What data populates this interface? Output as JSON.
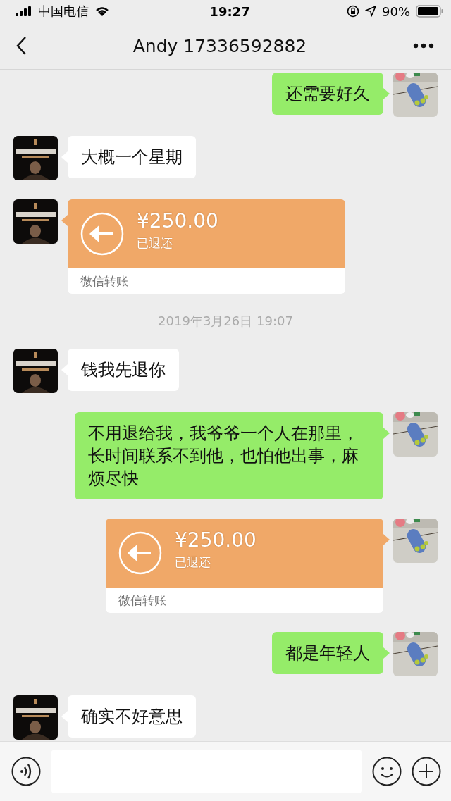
{
  "status_bar": {
    "carrier": "中国电信",
    "time": "19:27",
    "battery": "90%"
  },
  "nav": {
    "title": "Andy 17336592882"
  },
  "messages": [
    {
      "kind": "text",
      "outgoing": true,
      "text": "还需要好久"
    },
    {
      "kind": "text",
      "outgoing": false,
      "text": "大概一个星期"
    },
    {
      "kind": "transfer",
      "outgoing": false,
      "amount": "¥250.00",
      "status": "已退还",
      "label": "微信转账"
    },
    {
      "kind": "time",
      "text": "2019年3月26日 19:07"
    },
    {
      "kind": "text",
      "outgoing": false,
      "text": "钱我先退你"
    },
    {
      "kind": "text",
      "outgoing": true,
      "text": "不用退给我，我爷爷一个人在那里，长时间联系不到他，也怕他出事，麻烦尽快"
    },
    {
      "kind": "transfer",
      "outgoing": true,
      "amount": "¥250.00",
      "status": "已退还",
      "label": "微信转账"
    },
    {
      "kind": "text",
      "outgoing": true,
      "text": "都是年轻人"
    },
    {
      "kind": "text",
      "outgoing": false,
      "text": "确实不好意思"
    }
  ]
}
